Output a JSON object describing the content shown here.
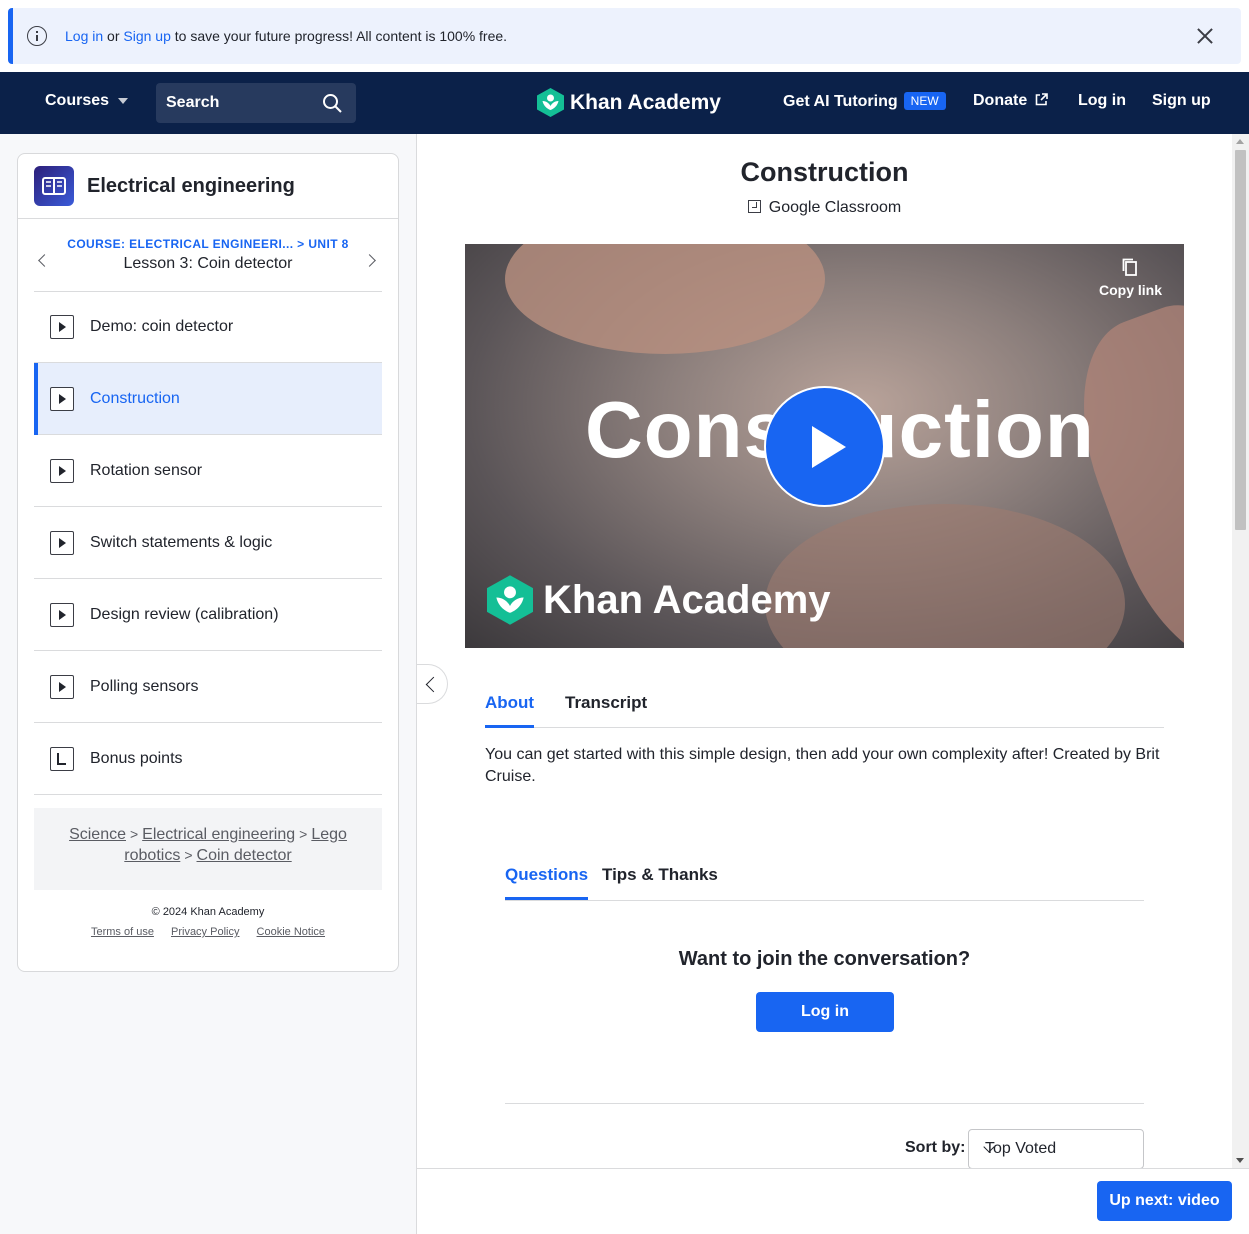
{
  "banner": {
    "login_link": "Log in",
    "or_text": " or ",
    "signup_link": "Sign up",
    "message": " to save your future progress! All content is 100% free."
  },
  "header": {
    "courses_label": "Courses",
    "search_label": "Search",
    "logo_text": "Khan Academy",
    "ai_tutoring_label": "Get AI Tutoring",
    "new_badge": "NEW",
    "donate_label": "Donate",
    "login_label": "Log in",
    "signup_label": "Sign up"
  },
  "sidebar": {
    "course_title": "Electrical engineering",
    "breadcrumb_course": "COURSE: ELECTRICAL ENGINEERI...",
    "breadcrumb_sep": " > ",
    "breadcrumb_unit": "UNIT 8",
    "lesson_name": "Lesson 3: Coin detector",
    "items": [
      {
        "label": "Demo: coin detector",
        "icon": "play-icon",
        "active": false
      },
      {
        "label": "Construction",
        "icon": "play-icon",
        "active": true
      },
      {
        "label": "Rotation sensor",
        "icon": "play-icon",
        "active": false
      },
      {
        "label": "Switch statements & logic",
        "icon": "play-icon",
        "active": false
      },
      {
        "label": "Design review (calibration)",
        "icon": "play-icon",
        "active": false
      },
      {
        "label": "Polling sensors",
        "icon": "play-icon",
        "active": false
      },
      {
        "label": "Bonus points",
        "icon": "document-icon",
        "active": false
      }
    ],
    "bread": {
      "science": "Science",
      "electrical": "Electrical engineering",
      "lego": "Lego",
      "robotics": "robotics",
      "coin": "Coin detector",
      "sep": ">"
    },
    "footer": {
      "copyright": "© 2024 Khan Academy",
      "terms": "Terms of use",
      "privacy": "Privacy Policy",
      "cookie": "Cookie Notice"
    }
  },
  "main": {
    "title": "Construction",
    "google_classroom": "Google Classroom",
    "video": {
      "overlay_text": "Construction",
      "copy_link": "Copy link",
      "watermark": "Khan Academy"
    },
    "tabs": {
      "about": "About",
      "transcript": "Transcript"
    },
    "about_text": "You can get started with this simple design, then add your own complexity after! Created by Brit Cruise.",
    "discussion_tabs": {
      "questions": "Questions",
      "tips": "Tips & Thanks"
    },
    "join_prompt": "Want to join the conversation?",
    "login_button": "Log in",
    "sort_label": "Sort by:",
    "sort_value": "Top Voted",
    "up_next": "Up next: video"
  },
  "colors": {
    "accent": "#1865f2",
    "header_bg": "#0b2149",
    "brand_green": "#14bf96"
  }
}
